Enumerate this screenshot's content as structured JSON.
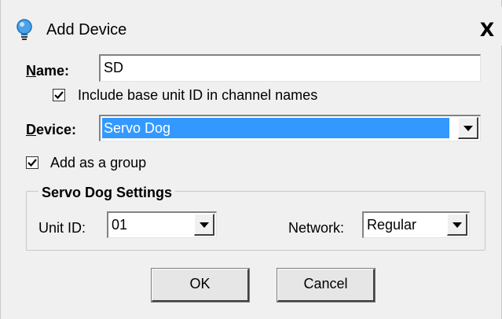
{
  "window": {
    "title": "Add Device",
    "close_symbol": "X"
  },
  "name_field": {
    "label_accel": "N",
    "label_rest": "ame:",
    "value": "SD"
  },
  "include_base_unit": {
    "checked": true,
    "label": "Include base unit ID in channel names"
  },
  "device_field": {
    "label_accel": "D",
    "label_rest": "evice:",
    "selected": "Servo Dog"
  },
  "add_as_group": {
    "checked": true,
    "label_pre": "Add as a ",
    "label_accel": "g",
    "label_post": "roup"
  },
  "settings_group": {
    "title": "Servo Dog Settings",
    "unit_id_label": "Unit ID:",
    "unit_id_value": "01",
    "network_label": "Network:",
    "network_value": "Regular"
  },
  "buttons": {
    "ok": "OK",
    "cancel": "Cancel"
  },
  "icons": {
    "title": "lightbulb-icon",
    "close": "close-icon",
    "dropdown": "chevron-down-icon",
    "check": "checkmark-icon"
  },
  "colors": {
    "selection": "#3399ff",
    "dialog_bg": "#f0f0f0"
  }
}
